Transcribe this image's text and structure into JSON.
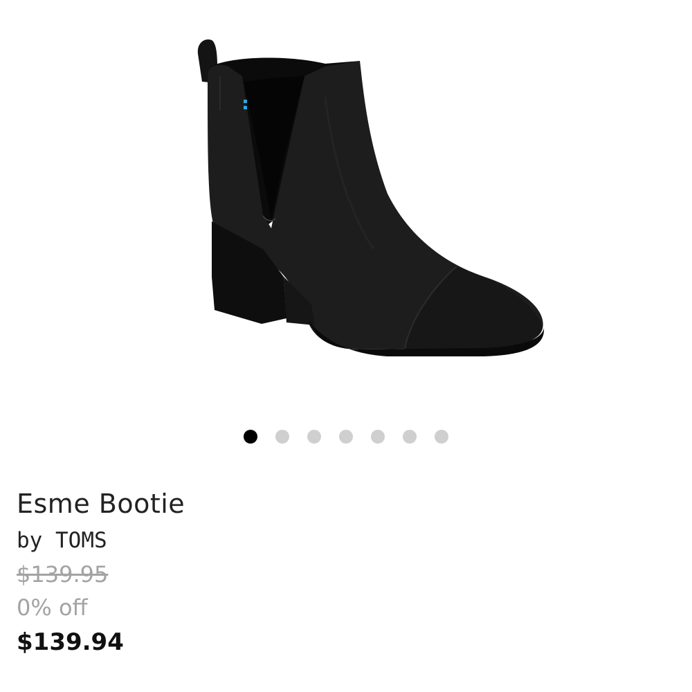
{
  "product": {
    "title": "Esme Bootie",
    "brand_line": "by TOMS",
    "original_price": "$139.95",
    "discount": "0% off",
    "sale_price": "$139.94",
    "image_icon": "ankle-boot-image"
  },
  "carousel": {
    "total_slides": 7,
    "active_index": 0
  },
  "colors": {
    "active_dot": "#000000",
    "inactive_dot": "#cfcfcf",
    "muted_text": "#a3a3a3",
    "boot_accent": "#29a8e0"
  }
}
